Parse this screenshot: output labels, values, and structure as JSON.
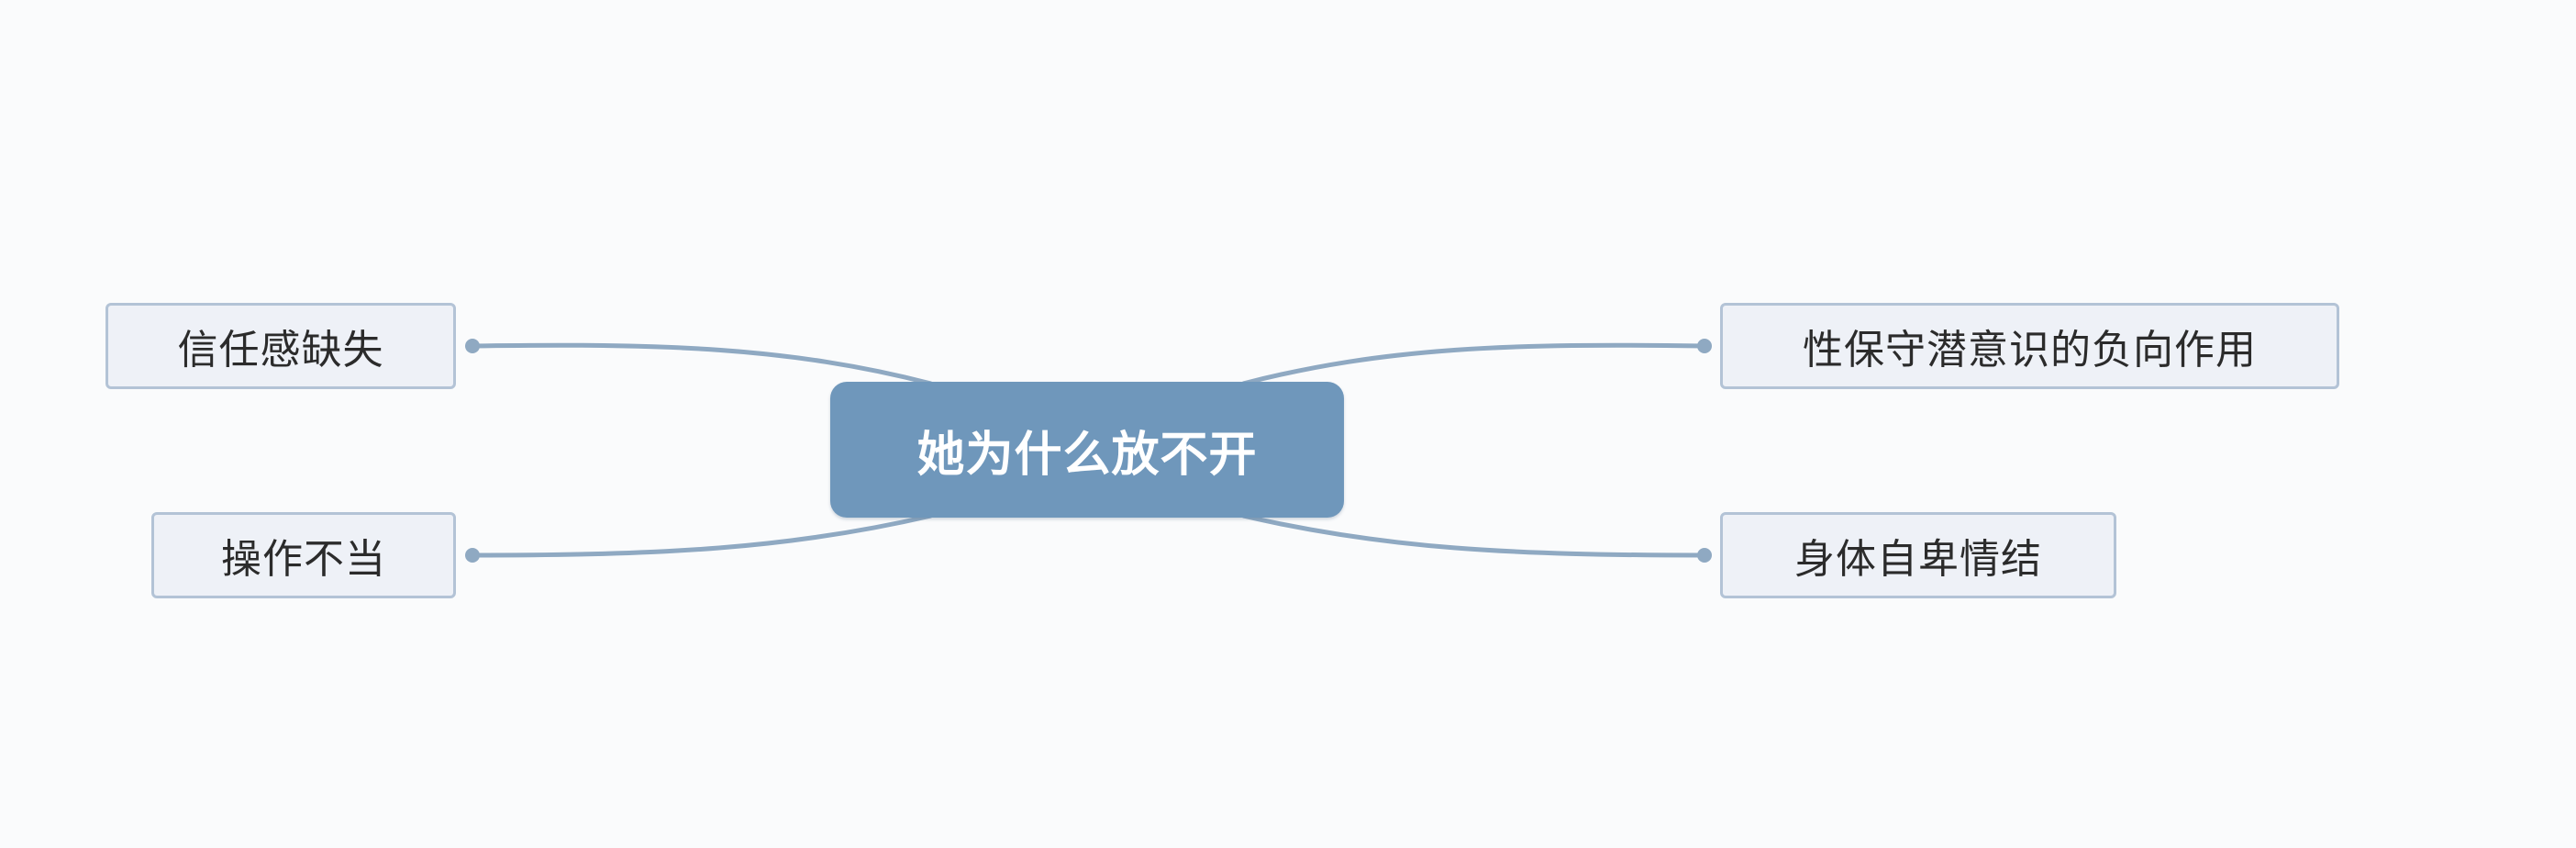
{
  "central_topic": "她为什么放不开",
  "branches": [
    {
      "label": "信任感缺失"
    },
    {
      "label": "操作不当"
    },
    {
      "label": "性保守潜意识的负向作用"
    },
    {
      "label": "身体自卑情结"
    }
  ],
  "colors": {
    "central_fill": "#6f97bb",
    "central_text": "#ffffff",
    "branch_fill": "#eef1f7",
    "branch_border": "#b3c3d6",
    "connector": "#8fa9c2",
    "background": "#fafbfc"
  }
}
